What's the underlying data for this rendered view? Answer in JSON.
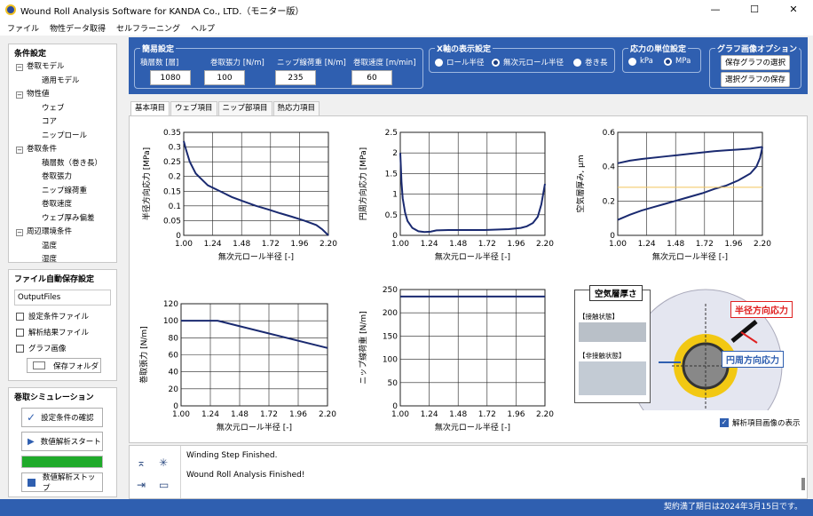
{
  "app": {
    "title": "Wound Roll Analysis Software for KANDA Co., LTD.（モニター版）"
  },
  "window": {
    "minimize": "—",
    "maximize": "☐",
    "close": "✕"
  },
  "menu": [
    "ファイル",
    "物性データ取得",
    "セルフラーニング",
    "ヘルプ"
  ],
  "conditions": {
    "title": "条件設定",
    "items": [
      {
        "label": "巻取モデル",
        "level": 1,
        "toggle": "−"
      },
      {
        "label": "適用モデル",
        "level": 2
      },
      {
        "label": "物性値",
        "level": 1,
        "toggle": "−"
      },
      {
        "label": "ウェブ",
        "level": 2
      },
      {
        "label": "コア",
        "level": 2
      },
      {
        "label": "ニップロール",
        "level": 2
      },
      {
        "label": "巻取条件",
        "level": 1,
        "toggle": "−"
      },
      {
        "label": "積層数（巻き長）",
        "level": 2
      },
      {
        "label": "巻取張力",
        "level": 2
      },
      {
        "label": "ニップ線荷重",
        "level": 2
      },
      {
        "label": "巻取速度",
        "level": 2
      },
      {
        "label": "ウェブ厚み偏差",
        "level": 2
      },
      {
        "label": "周辺環境条件",
        "level": 1,
        "toggle": "−"
      },
      {
        "label": "温度",
        "level": 2
      },
      {
        "label": "湿度",
        "level": 2
      }
    ]
  },
  "autosave": {
    "title": "ファイル自動保存設定",
    "folder": "OutputFiles",
    "checks": [
      "設定条件ファイル",
      "解析結果ファイル",
      "グラフ画像"
    ],
    "save_folder": "保存フォルダ"
  },
  "simulation": {
    "title": "巻取シミュレーション",
    "confirm": "設定条件の確認",
    "start": "数値解析スタート",
    "stop": "数値解析ストップ",
    "progress": 1.0
  },
  "simple": {
    "title": "簡易設定",
    "fields": [
      {
        "label": "積層数 [層]",
        "value": "1080"
      },
      {
        "label": "巻取張力 [N/m]",
        "value": "100"
      },
      {
        "label": "ニップ線荷重 [N/m]",
        "value": "235"
      },
      {
        "label": "巻取速度 [m/min]",
        "value": "60"
      }
    ]
  },
  "xaxis_setting": {
    "title": "X軸の表示設定",
    "options": [
      "ロール半径",
      "無次元ロール半径",
      "巻き長"
    ],
    "selected": 1
  },
  "unit_setting": {
    "title": "応力の単位設定",
    "options": [
      "kPa",
      "MPa"
    ],
    "selected": 1
  },
  "graph_img": {
    "title": "グラフ画像オプション",
    "save_selected": "保存グラフの選択",
    "select_save": "選択グラフの保存"
  },
  "tabs": [
    "基本項目",
    "ウェブ項目",
    "ニップ部項目",
    "熱応力項目"
  ],
  "show_image": "解析項目画像の表示",
  "diagram": {
    "air_title": "空気層厚さ",
    "contact": "【接触状態】",
    "noncontact": "【非接触状態】",
    "radial": "半径方向応力",
    "hoop": "円周方向応力"
  },
  "log": [
    "Winding Step Finished.",
    "Wound Roll Analysis Finished!"
  ],
  "status": "契約満了期日は2024年3月15日です。",
  "chart_data": [
    {
      "type": "line",
      "title": "",
      "ylabel": "半径方向応力 [MPa]",
      "xlabel": "無次元ロール半径 [-]",
      "xlim": [
        1.0,
        2.2
      ],
      "ylim": [
        0,
        0.35
      ],
      "xticks": [
        "1.00",
        "1.24",
        "1.48",
        "1.72",
        "1.96",
        "2.20"
      ],
      "yticks": [
        "0",
        "0.05",
        "0.1",
        "0.15",
        "0.2",
        "0.25",
        "0.3",
        "0.35"
      ],
      "series": [
        {
          "color": "#1a2a70",
          "x": [
            1.0,
            1.02,
            1.05,
            1.1,
            1.15,
            1.2,
            1.3,
            1.4,
            1.5,
            1.6,
            1.7,
            1.8,
            1.9,
            2.0,
            2.1,
            2.15,
            2.2
          ],
          "y": [
            0.32,
            0.29,
            0.25,
            0.21,
            0.19,
            0.17,
            0.15,
            0.13,
            0.115,
            0.1,
            0.088,
            0.075,
            0.063,
            0.05,
            0.035,
            0.02,
            0.0
          ]
        }
      ]
    },
    {
      "type": "line",
      "title": "",
      "ylabel": "円周方向応力 [MPa]",
      "xlabel": "無次元ロール半径 [-]",
      "xlim": [
        1.0,
        2.2
      ],
      "ylim": [
        0,
        2.5
      ],
      "xticks": [
        "1.00",
        "1.24",
        "1.48",
        "1.72",
        "1.96",
        "2.20"
      ],
      "yticks": [
        "0",
        "0.5",
        "1",
        "1.5",
        "2",
        "2.5"
      ],
      "series": [
        {
          "color": "#1a2a70",
          "x": [
            1.0,
            1.01,
            1.02,
            1.04,
            1.06,
            1.1,
            1.15,
            1.2,
            1.25,
            1.3,
            1.4,
            1.5,
            1.6,
            1.7,
            1.8,
            1.9,
            2.0,
            2.05,
            2.1,
            2.14,
            2.17,
            2.2
          ],
          "y": [
            2.0,
            1.3,
            0.9,
            0.55,
            0.35,
            0.18,
            0.1,
            0.08,
            0.09,
            0.12,
            0.13,
            0.13,
            0.13,
            0.13,
            0.14,
            0.15,
            0.18,
            0.22,
            0.3,
            0.45,
            0.75,
            1.25
          ]
        }
      ]
    },
    {
      "type": "line",
      "title": "",
      "ylabel": "空気層厚み, μm",
      "xlabel": "無次元ロール半径 [-]",
      "xlim": [
        1.0,
        2.2
      ],
      "ylim": [
        0,
        0.6
      ],
      "xticks": [
        "1.00",
        "1.24",
        "1.48",
        "1.72",
        "1.96",
        "2.20"
      ],
      "yticks": [
        "0",
        "0.2",
        "0.4",
        "0.6"
      ],
      "series": [
        {
          "color": "#1a2a70",
          "x": [
            1.0,
            1.1,
            1.2,
            1.4,
            1.6,
            1.8,
            1.9,
            2.0,
            2.1,
            2.15,
            2.2
          ],
          "y": [
            0.42,
            0.435,
            0.445,
            0.46,
            0.475,
            0.49,
            0.495,
            0.5,
            0.505,
            0.51,
            0.515
          ]
        },
        {
          "color": "#1a2a70",
          "x": [
            1.0,
            1.1,
            1.2,
            1.3,
            1.4,
            1.5,
            1.6,
            1.7,
            1.8,
            1.9,
            2.0,
            2.05,
            2.1,
            2.15,
            2.18,
            2.2
          ],
          "y": [
            0.09,
            0.12,
            0.145,
            0.165,
            0.185,
            0.205,
            0.225,
            0.245,
            0.27,
            0.29,
            0.32,
            0.34,
            0.36,
            0.4,
            0.45,
            0.515
          ]
        },
        {
          "color": "#f2c45a",
          "x": [
            1.0,
            2.2
          ],
          "y": [
            0.28,
            0.28
          ]
        }
      ]
    },
    {
      "type": "line",
      "title": "",
      "ylabel": "巻取張力 [N/m]",
      "xlabel": "無次元ロール半径 [-]",
      "xlim": [
        1.0,
        2.2
      ],
      "ylim": [
        0,
        120
      ],
      "xticks": [
        "1.00",
        "1.24",
        "1.48",
        "1.72",
        "1.96",
        "2.20"
      ],
      "yticks": [
        "0",
        "20",
        "40",
        "60",
        "80",
        "100",
        "120"
      ],
      "series": [
        {
          "color": "#1a2a70",
          "x": [
            1.0,
            1.3,
            2.2
          ],
          "y": [
            100,
            100,
            68
          ]
        }
      ]
    },
    {
      "type": "line",
      "title": "",
      "ylabel": "ニップ線荷重 [N/m]",
      "xlabel": "無次元ロール半径 [-]",
      "xlim": [
        1.0,
        2.2
      ],
      "ylim": [
        0,
        250
      ],
      "xticks": [
        "1.00",
        "1.24",
        "1.48",
        "1.72",
        "1.96",
        "2.20"
      ],
      "yticks": [
        "0",
        "50",
        "100",
        "150",
        "200",
        "250"
      ],
      "series": [
        {
          "color": "#1a2a70",
          "x": [
            1.0,
            2.2
          ],
          "y": [
            235,
            235
          ]
        }
      ]
    }
  ]
}
